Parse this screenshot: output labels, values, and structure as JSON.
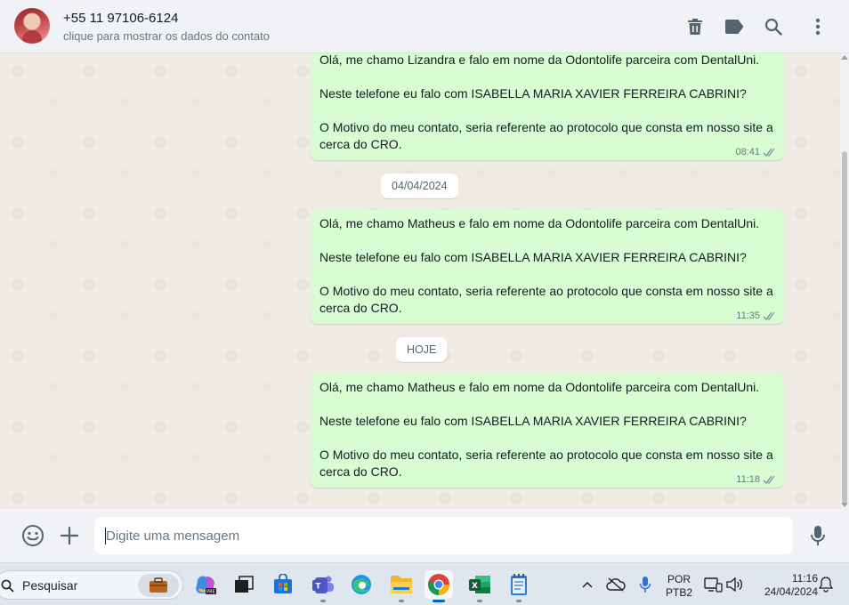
{
  "header": {
    "contact_name": "+55 11 97106-6124",
    "contact_subtitle": "clique para mostrar os dados do contato",
    "icons": [
      "trash-icon",
      "label-icon",
      "search-icon",
      "menu-icon"
    ]
  },
  "messages": [
    {
      "paragraphs": [
        "Olá, me chamo Lizandra e falo em nome da Odontolife parceira com DentalUni.",
        "Neste telefone eu falo com ISABELLA MARIA XAVIER FERREIRA CABRINI?",
        "O Motivo do meu contato, seria referente ao protocolo que consta em nosso site a cerca do CRO."
      ],
      "time": "08:41"
    },
    {
      "paragraphs": [
        "Olá, me chamo Matheus e falo em nome da Odontolife parceira com DentalUni.",
        "Neste telefone eu falo com ISABELLA MARIA XAVIER FERREIRA CABRINI?",
        "O Motivo do meu contato, seria referente ao protocolo que consta em nosso site a cerca do CRO."
      ],
      "time": "11:35"
    },
    {
      "paragraphs": [
        "Olá, me chamo Matheus e falo em nome da Odontolife parceira com DentalUni.",
        "Neste telefone eu falo com ISABELLA MARIA XAVIER FERREIRA CABRINI?",
        "O Motivo do meu contato, seria referente ao protocolo que consta em nosso site a cerca do CRO."
      ],
      "time": "11:18"
    }
  ],
  "date_chips": [
    "04/04/2024",
    "HOJE"
  ],
  "composer": {
    "placeholder": "Digite uma mensagem"
  },
  "taskbar": {
    "search_label": "Pesquisar",
    "language_line1": "POR",
    "language_line2": "PTB2",
    "clock_time": "11:16",
    "clock_date": "24/04/2024"
  },
  "colors": {
    "outgoing_bubble": "#d9fdd3",
    "chat_background": "#efeae2",
    "header_background": "#f0f2f5",
    "read_ticks": "#8696a0"
  }
}
